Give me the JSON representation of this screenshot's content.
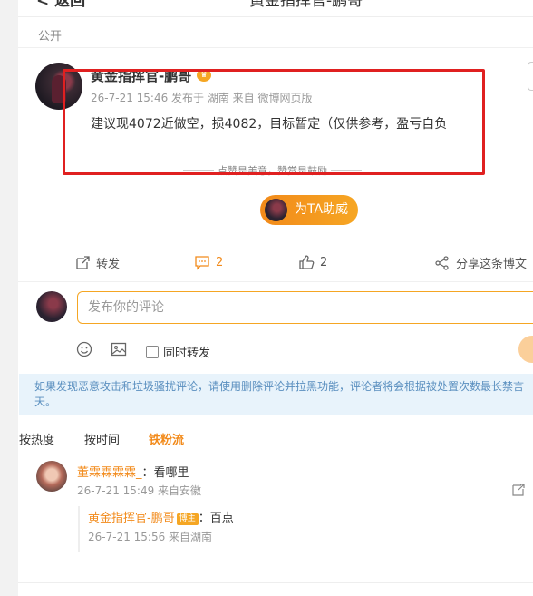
{
  "header": {
    "back_label": "< 返回",
    "title": "黄金指挥官-鹏哥"
  },
  "post": {
    "visibility": "公开",
    "author": "黄金指挥官-鹏哥",
    "meta": "26-7-21 15:46 发布于 湖南 来自 微博网页版",
    "text": "建议现4072近做空，损4082，目标暂定（仅供参考，盈亏自负",
    "praise_line": "点赞是美意，赞赏是鼓励",
    "cheer_label": "为TA助威"
  },
  "actions": {
    "repost_label": "转发",
    "comment_count": "2",
    "like_count": "2",
    "share_label": "分享这条博文"
  },
  "composer": {
    "placeholder": "发布你的评论",
    "repost_checkbox_label": "同时转发"
  },
  "notice": {
    "line1": "如果发现恶意攻击和垃圾骚扰评论，请使用删除评论并拉黑功能，评论者将会根据被处置次数最长禁言",
    "line2": "天。"
  },
  "sort": {
    "hot": "按热度",
    "time": "按时间",
    "fans": "铁粉流"
  },
  "comments": [
    {
      "user": "董霖霖霖霖_",
      "text": "：看哪里",
      "meta": "26-7-21 15:49 来自安徽",
      "reply": {
        "user": "黄金指挥官-鹏哥",
        "badge": "博主",
        "text": "：百点",
        "meta": "26-7-21 15:56 来自湖南"
      }
    }
  ],
  "colors": {
    "accent": "#f28a1a",
    "highlight_box": "#e02020",
    "notice_bg": "#e8f3fb"
  }
}
